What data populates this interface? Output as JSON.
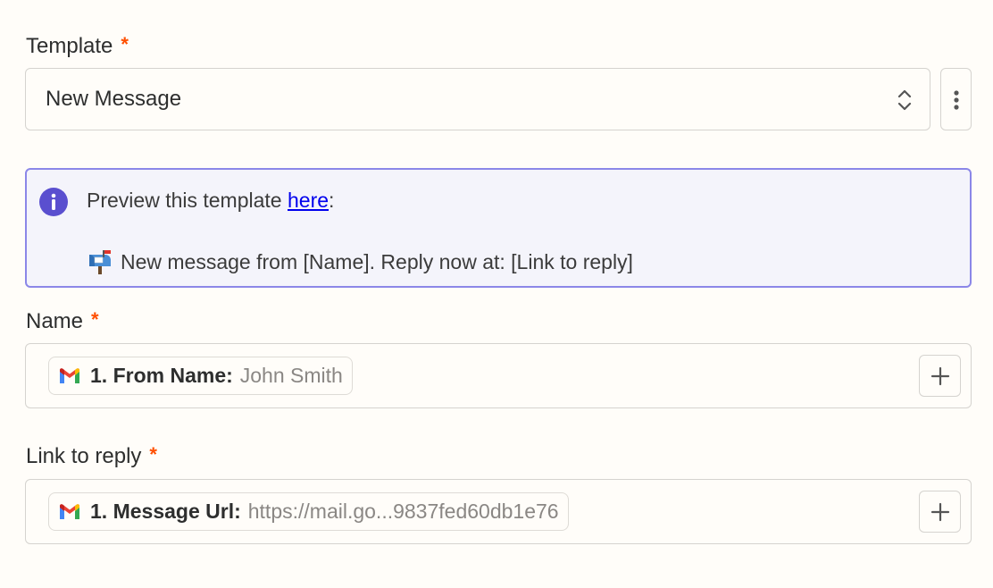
{
  "template": {
    "label": "Template",
    "required_mark": "*",
    "value": "New Message"
  },
  "info": {
    "text_before": "Preview this template ",
    "link": "here",
    "text_after": ":",
    "preview": "New message from [Name]. Reply now at: [Link to reply]"
  },
  "name_field": {
    "label": "Name",
    "required_mark": "*",
    "pill_key": "1. From Name:",
    "pill_value": "John Smith"
  },
  "link_field": {
    "label": "Link to reply",
    "required_mark": "*",
    "pill_key": "1. Message Url:",
    "pill_value": "https://mail.go...9837fed60db1e76"
  },
  "colors": {
    "required": "#ff4f00",
    "info_border": "#8b87e8",
    "info_icon": "#5a4fcf",
    "link": "#0000ee"
  },
  "icons": {
    "select_arrows": "chevron-up-down-icon",
    "more": "vertical-dots-icon",
    "info": "info-icon",
    "mailbox": "mailbox-icon",
    "gmail": "gmail-icon",
    "plus": "plus-icon"
  }
}
